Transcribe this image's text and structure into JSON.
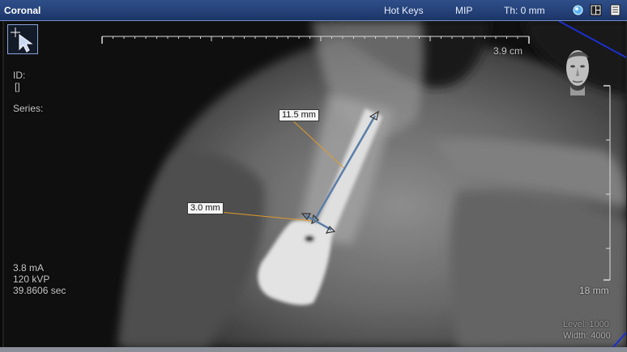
{
  "window": {
    "title": "Coronal",
    "menus": [
      "Hot Keys",
      "MIP",
      "Th: 0 mm"
    ],
    "icons": [
      "sphere-icon",
      "layout-icon",
      "report-icon"
    ]
  },
  "overlay": {
    "id_label": "ID:",
    "id_value": "[]",
    "series_label": "Series:",
    "ma": "3.8 mA",
    "kvp": "120 kVP",
    "time": "39.8606 sec",
    "scale_top": "3.9 cm",
    "scale_right": "18 mm",
    "level": "Level: 1000",
    "width": "Width: 4000"
  },
  "measurements": [
    {
      "label": "11.5 mm"
    },
    {
      "label": "3.0 mm"
    }
  ],
  "colors": {
    "measure_line": "#5a7ea8",
    "leader_line": "#e09a2a",
    "title_bar": "#24407a"
  }
}
